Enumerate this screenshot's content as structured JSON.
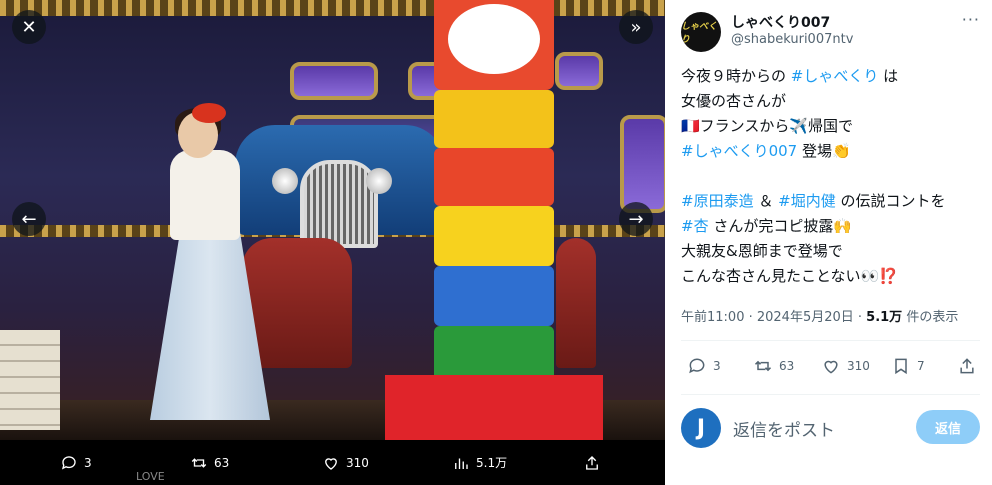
{
  "media": {
    "actions": {
      "replies": "3",
      "retweets": "63",
      "likes": "310",
      "views": "5.1万"
    },
    "replier_label": "LOVE"
  },
  "tweet": {
    "display_name": "しゃべくり007",
    "handle": "@shabekuri007ntv",
    "avatar_text": "しゃべくり",
    "lines": [
      [
        {
          "t": "今夜９時からの "
        },
        {
          "t": "#しゃべくり",
          "h": true
        },
        {
          "t": " は"
        }
      ],
      [
        {
          "t": "女優の杏さんが"
        }
      ],
      [
        {
          "t": "🇫🇷フランスから✈️帰国で"
        }
      ],
      [
        {
          "t": "#しゃべくり007",
          "h": true
        },
        {
          "t": " 登場👏"
        }
      ],
      [
        {
          "t": ""
        }
      ],
      [
        {
          "t": "#原田泰造",
          "h": true
        },
        {
          "t": " ＆ "
        },
        {
          "t": "#堀内健",
          "h": true
        },
        {
          "t": " の伝説コントを"
        }
      ],
      [
        {
          "t": "#杏",
          "h": true
        },
        {
          "t": " さんが完コピ披露🙌"
        }
      ],
      [
        {
          "t": "大親友&恩師まで登場で"
        }
      ],
      [
        {
          "t": "こんな杏さん見たことない👀⁉️"
        }
      ]
    ],
    "time": "午前11:00 · 2024年5月20日 · ",
    "views_count": "5.1万",
    "views_label": " 件の表示",
    "actions": {
      "replies": "3",
      "retweets": "63",
      "likes": "310",
      "bookmarks": "7"
    }
  },
  "reply": {
    "avatar_letter": "J",
    "placeholder": "返信をポスト",
    "button": "返信"
  }
}
